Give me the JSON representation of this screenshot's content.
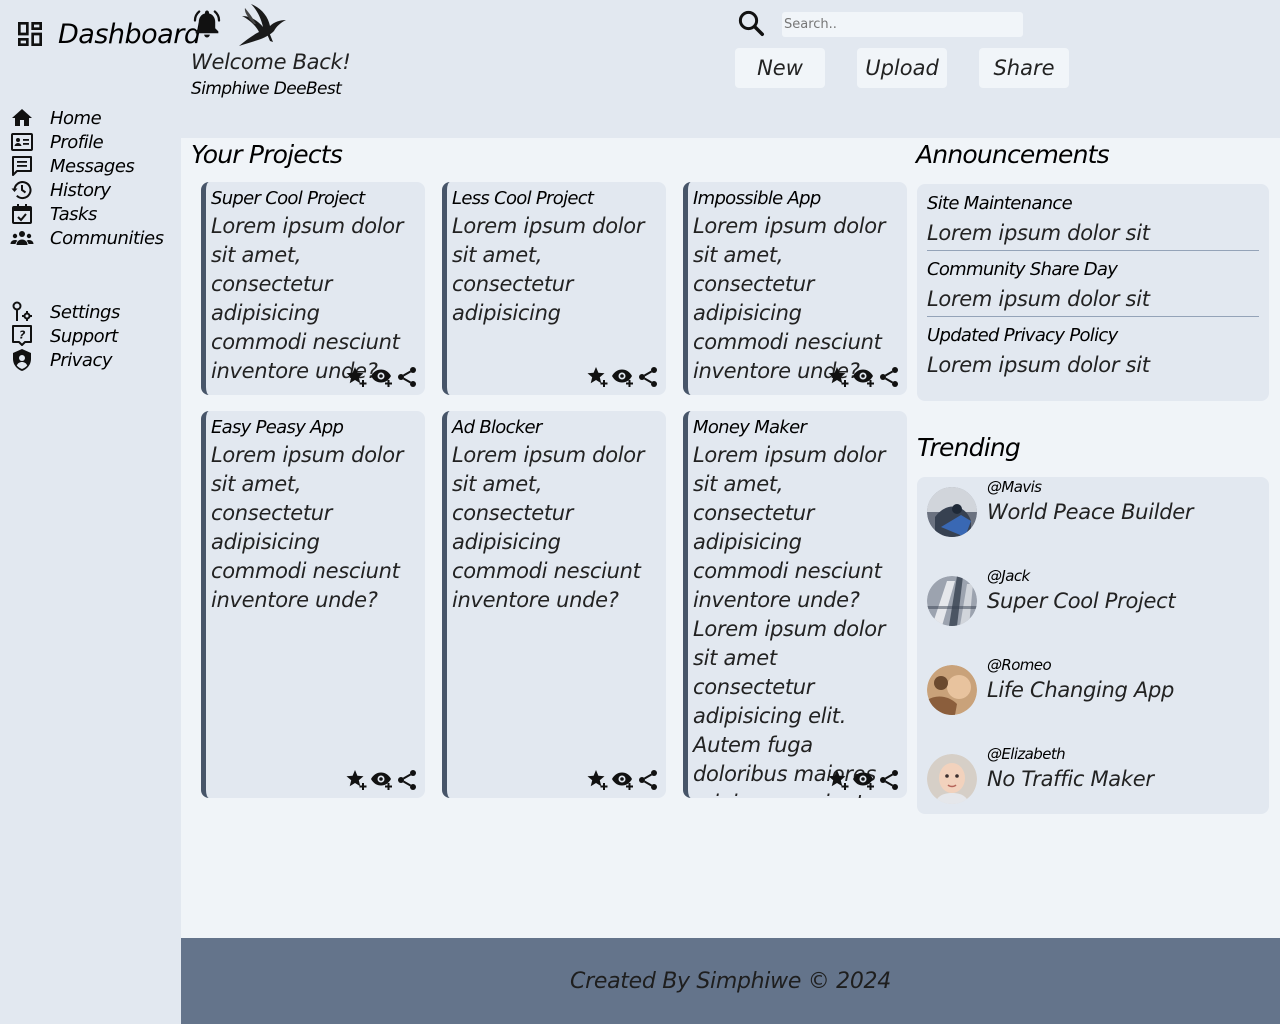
{
  "brand": {
    "title": "Dashboard",
    "icon": "dashboard-icon"
  },
  "header": {
    "welcome": "Welcome Back!",
    "username": "Simphiwe DeeBest",
    "search_placeholder": "Search..",
    "buttons": {
      "new": "New",
      "upload": "Upload",
      "share": "Share"
    }
  },
  "sidebar": {
    "items": [
      {
        "label": "Home",
        "icon": "home-icon"
      },
      {
        "label": "Profile",
        "icon": "id-card-icon"
      },
      {
        "label": "Messages",
        "icon": "message-icon"
      },
      {
        "label": "History",
        "icon": "history-icon"
      },
      {
        "label": "Tasks",
        "icon": "calendar-check-icon"
      },
      {
        "label": "Communities",
        "icon": "group-icon"
      }
    ],
    "secondary": [
      {
        "label": "Settings",
        "icon": "settings-icon"
      },
      {
        "label": "Support",
        "icon": "help-icon"
      },
      {
        "label": "Privacy",
        "icon": "shield-icon"
      }
    ]
  },
  "projects": {
    "heading": "Your Projects",
    "items": [
      {
        "title": "Super Cool Project",
        "desc": "Lorem ipsum dolor sit amet, consectetur adipisicing commodi nesciunt inventore unde?"
      },
      {
        "title": "Less Cool Project",
        "desc": "Lorem ipsum dolor sit amet, consectetur adipisicing"
      },
      {
        "title": "Impossible App",
        "desc": "Lorem ipsum dolor sit amet, consectetur adipisicing commodi nesciunt inventore unde?"
      },
      {
        "title": "Easy Peasy App",
        "desc": "Lorem ipsum dolor sit amet, consectetur adipisicing commodi nesciunt inventore unde?"
      },
      {
        "title": "Ad Blocker",
        "desc": "Lorem ipsum dolor sit amet, consectetur adipisicing commodi nesciunt inventore unde?"
      },
      {
        "title": "Money Maker",
        "desc": "Lorem ipsum dolor sit amet, consectetur adipisicing commodi nesciunt inventore unde? Lorem ipsum dolor sit amet consectetur adipisicing elit. Autem fuga doloribus maiores minima nesciunt vero"
      }
    ]
  },
  "announcements": {
    "heading": "Announcements",
    "items": [
      {
        "title": "Site Maintenance",
        "desc": "Lorem ipsum dolor sit"
      },
      {
        "title": "Community Share Day",
        "desc": "Lorem ipsum dolor sit"
      },
      {
        "title": "Updated Privacy Policy",
        "desc": "Lorem ipsum dolor sit"
      }
    ]
  },
  "trending": {
    "heading": "Trending",
    "items": [
      {
        "user": "@Mavis",
        "project": "World Peace Builder"
      },
      {
        "user": "@Jack",
        "project": "Super Cool Project"
      },
      {
        "user": "@Romeo",
        "project": "Life Changing App"
      },
      {
        "user": "@Elizabeth",
        "project": "No Traffic Maker"
      }
    ]
  },
  "footer": {
    "text": "Created By Simphiwe © 2024"
  },
  "colors": {
    "sidebar_bg": "#e2e8f0",
    "main_bg": "#f0f4f8",
    "card_border": "#475569",
    "footer_bg": "#64748b"
  }
}
